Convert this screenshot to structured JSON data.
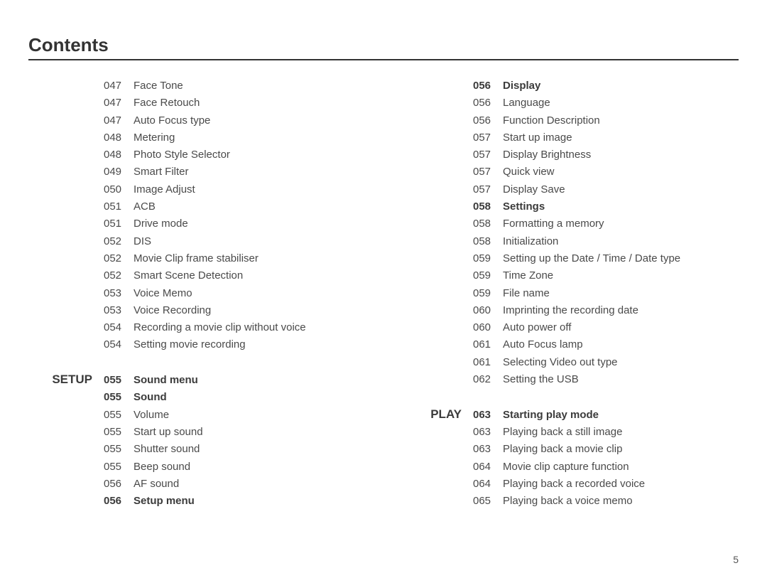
{
  "title": "Contents",
  "pageNumber": "5",
  "columns": [
    [
      {
        "section": "",
        "pg": "047",
        "label": "Face Tone"
      },
      {
        "section": "",
        "pg": "047",
        "label": "Face Retouch"
      },
      {
        "section": "",
        "pg": "047",
        "label": "Auto Focus type"
      },
      {
        "section": "",
        "pg": "048",
        "label": "Metering"
      },
      {
        "section": "",
        "pg": "048",
        "label": "Photo Style Selector"
      },
      {
        "section": "",
        "pg": "049",
        "label": "Smart Filter"
      },
      {
        "section": "",
        "pg": "050",
        "label": "Image Adjust"
      },
      {
        "section": "",
        "pg": "051",
        "label": "ACB"
      },
      {
        "section": "",
        "pg": "051",
        "label": "Drive mode"
      },
      {
        "section": "",
        "pg": "052",
        "label": "DIS"
      },
      {
        "section": "",
        "pg": "052",
        "label": "Movie Clip frame stabiliser"
      },
      {
        "section": "",
        "pg": "052",
        "label": "Smart Scene Detection"
      },
      {
        "section": "",
        "pg": "053",
        "label": "Voice Memo"
      },
      {
        "section": "",
        "pg": "053",
        "label": "Voice Recording"
      },
      {
        "section": "",
        "pg": "054",
        "label": "Recording a movie clip without voice"
      },
      {
        "section": "",
        "pg": "054",
        "label": "Setting movie recording"
      },
      {
        "spacer": true
      },
      {
        "section": "SETUP",
        "pg": "055",
        "label": "Sound menu",
        "bold": true
      },
      {
        "section": "",
        "pg": "055",
        "label": "Sound",
        "bold": true
      },
      {
        "section": "",
        "pg": "055",
        "label": "Volume"
      },
      {
        "section": "",
        "pg": "055",
        "label": "Start up sound"
      },
      {
        "section": "",
        "pg": "055",
        "label": "Shutter sound"
      },
      {
        "section": "",
        "pg": "055",
        "label": "Beep sound"
      },
      {
        "section": "",
        "pg": "056",
        "label": "AF sound"
      },
      {
        "section": "",
        "pg": "056",
        "label": "Setup menu",
        "bold": true
      }
    ],
    [
      {
        "section": "",
        "pg": "056",
        "label": "Display",
        "bold": true
      },
      {
        "section": "",
        "pg": "056",
        "label": "Language"
      },
      {
        "section": "",
        "pg": "056",
        "label": "Function Description"
      },
      {
        "section": "",
        "pg": "057",
        "label": "Start up image"
      },
      {
        "section": "",
        "pg": "057",
        "label": "Display Brightness"
      },
      {
        "section": "",
        "pg": "057",
        "label": "Quick view"
      },
      {
        "section": "",
        "pg": "057",
        "label": "Display Save"
      },
      {
        "section": "",
        "pg": "058",
        "label": "Settings",
        "bold": true
      },
      {
        "section": "",
        "pg": "058",
        "label": "Formatting a memory"
      },
      {
        "section": "",
        "pg": "058",
        "label": "Initialization"
      },
      {
        "section": "",
        "pg": "059",
        "label": "Setting up the Date / Time / Date type"
      },
      {
        "section": "",
        "pg": "059",
        "label": "Time Zone"
      },
      {
        "section": "",
        "pg": "059",
        "label": "File name"
      },
      {
        "section": "",
        "pg": "060",
        "label": "Imprinting the recording date"
      },
      {
        "section": "",
        "pg": "060",
        "label": "Auto power off"
      },
      {
        "section": "",
        "pg": "061",
        "label": "Auto Focus lamp"
      },
      {
        "section": "",
        "pg": "061",
        "label": "Selecting Video out type"
      },
      {
        "section": "",
        "pg": "062",
        "label": "Setting the USB"
      },
      {
        "spacer": true
      },
      {
        "section": "PLAY",
        "pg": "063",
        "label": "Starting play mode",
        "bold": true
      },
      {
        "section": "",
        "pg": "063",
        "label": "Playing back a still image"
      },
      {
        "section": "",
        "pg": "063",
        "label": "Playing back a movie clip"
      },
      {
        "section": "",
        "pg": "064",
        "label": "Movie clip capture function"
      },
      {
        "section": "",
        "pg": "064",
        "label": "Playing back a recorded voice"
      },
      {
        "section": "",
        "pg": "065",
        "label": "Playing back a voice memo"
      }
    ]
  ]
}
